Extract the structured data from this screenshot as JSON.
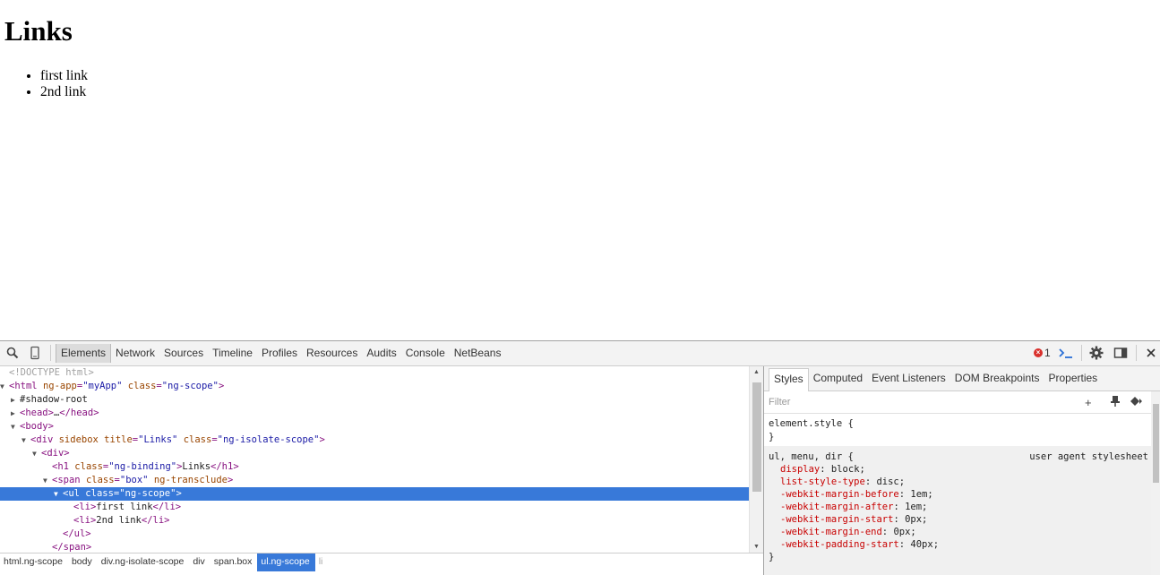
{
  "page": {
    "heading": "Links",
    "links": [
      "first link",
      "2nd link"
    ]
  },
  "devtools": {
    "tabs": [
      "Elements",
      "Network",
      "Sources",
      "Timeline",
      "Profiles",
      "Resources",
      "Audits",
      "Console",
      "NetBeans"
    ],
    "active_tab": "Elements",
    "error_count": "1",
    "icons": [
      "search-icon",
      "device-mode-icon",
      "error-icon",
      "console-drawer-icon",
      "gear-icon",
      "dock-icon",
      "close-icon"
    ],
    "dom_lines": [
      {
        "indent": 0,
        "tri": "",
        "html": "<!DOCTYPE html>",
        "kind": "comment"
      },
      {
        "indent": 0,
        "tri": "▼",
        "parts": [
          [
            "tg",
            "<html "
          ],
          [
            "at",
            "ng-app"
          ],
          [
            "tg",
            "="
          ],
          [
            "av",
            "\"myApp\""
          ],
          [
            "tg",
            " "
          ],
          [
            "at",
            "class"
          ],
          [
            "tg",
            "="
          ],
          [
            "av",
            "\"ng-scope\""
          ],
          [
            "tg",
            ">"
          ]
        ]
      },
      {
        "indent": 1,
        "tri": "▶",
        "parts": [
          [
            "tx",
            "#shadow-root"
          ]
        ]
      },
      {
        "indent": 1,
        "tri": "▶",
        "parts": [
          [
            "tg",
            "<head>"
          ],
          [
            "tx",
            "…"
          ],
          [
            "tg",
            "</head>"
          ]
        ]
      },
      {
        "indent": 1,
        "tri": "▼",
        "parts": [
          [
            "tg",
            "<body>"
          ]
        ]
      },
      {
        "indent": 2,
        "tri": "▼",
        "parts": [
          [
            "tg",
            "<div "
          ],
          [
            "at",
            "sidebox title"
          ],
          [
            "tg",
            "="
          ],
          [
            "av",
            "\"Links\""
          ],
          [
            "tg",
            " "
          ],
          [
            "at",
            "class"
          ],
          [
            "tg",
            "="
          ],
          [
            "av",
            "\"ng-isolate-scope\""
          ],
          [
            "tg",
            ">"
          ]
        ]
      },
      {
        "indent": 3,
        "tri": "▼",
        "parts": [
          [
            "tg",
            "<div>"
          ]
        ]
      },
      {
        "indent": 4,
        "tri": "",
        "parts": [
          [
            "tg",
            "<h1 "
          ],
          [
            "at",
            "class"
          ],
          [
            "tg",
            "="
          ],
          [
            "av",
            "\"ng-binding\""
          ],
          [
            "tg",
            ">"
          ],
          [
            "tx",
            "Links"
          ],
          [
            "tg",
            "</h1>"
          ]
        ]
      },
      {
        "indent": 4,
        "tri": "▼",
        "parts": [
          [
            "tg",
            "<span "
          ],
          [
            "at",
            "class"
          ],
          [
            "tg",
            "="
          ],
          [
            "av",
            "\"box\""
          ],
          [
            "tg",
            " "
          ],
          [
            "at",
            "ng-transclude"
          ],
          [
            "tg",
            ">"
          ]
        ]
      },
      {
        "indent": 5,
        "tri": "▼",
        "selected": true,
        "parts": [
          [
            "tg",
            "<ul "
          ],
          [
            "at",
            "class"
          ],
          [
            "tg",
            "="
          ],
          [
            "av",
            "\"ng-scope\""
          ],
          [
            "tg",
            ">"
          ]
        ]
      },
      {
        "indent": 6,
        "tri": "",
        "parts": [
          [
            "tg",
            "<li>"
          ],
          [
            "tx",
            "first link"
          ],
          [
            "tg",
            "</li>"
          ]
        ]
      },
      {
        "indent": 6,
        "tri": "",
        "parts": [
          [
            "tg",
            "<li>"
          ],
          [
            "tx",
            "2nd link"
          ],
          [
            "tg",
            "</li>"
          ]
        ]
      },
      {
        "indent": 5,
        "tri": "",
        "parts": [
          [
            "tg",
            "</ul>"
          ]
        ]
      },
      {
        "indent": 4,
        "tri": "",
        "parts": [
          [
            "tg",
            "</span>"
          ]
        ]
      }
    ],
    "breadcrumbs": [
      "html.ng-scope",
      "body",
      "div.ng-isolate-scope",
      "div",
      "span.box",
      "ul.ng-scope",
      "li"
    ],
    "active_breadcrumb": "ul.ng-scope",
    "sidebar_tabs": [
      "Styles",
      "Computed",
      "Event Listeners",
      "DOM Breakpoints",
      "Properties"
    ],
    "active_sidebar_tab": "Styles",
    "filter_placeholder": "Filter",
    "element_style_open": "element.style {",
    "element_style_close": "}",
    "ua_selector": "ul, menu, dir {",
    "ua_source": "user agent stylesheet",
    "ua_props": [
      [
        "display",
        "block;"
      ],
      [
        "list-style-type",
        "disc;"
      ],
      [
        "-webkit-margin-before",
        "1em;"
      ],
      [
        "-webkit-margin-after",
        "1em;"
      ],
      [
        "-webkit-margin-start",
        "0px;"
      ],
      [
        "-webkit-margin-end",
        "0px;"
      ],
      [
        "-webkit-padding-start",
        "40px;"
      ]
    ],
    "ua_close": "}"
  }
}
